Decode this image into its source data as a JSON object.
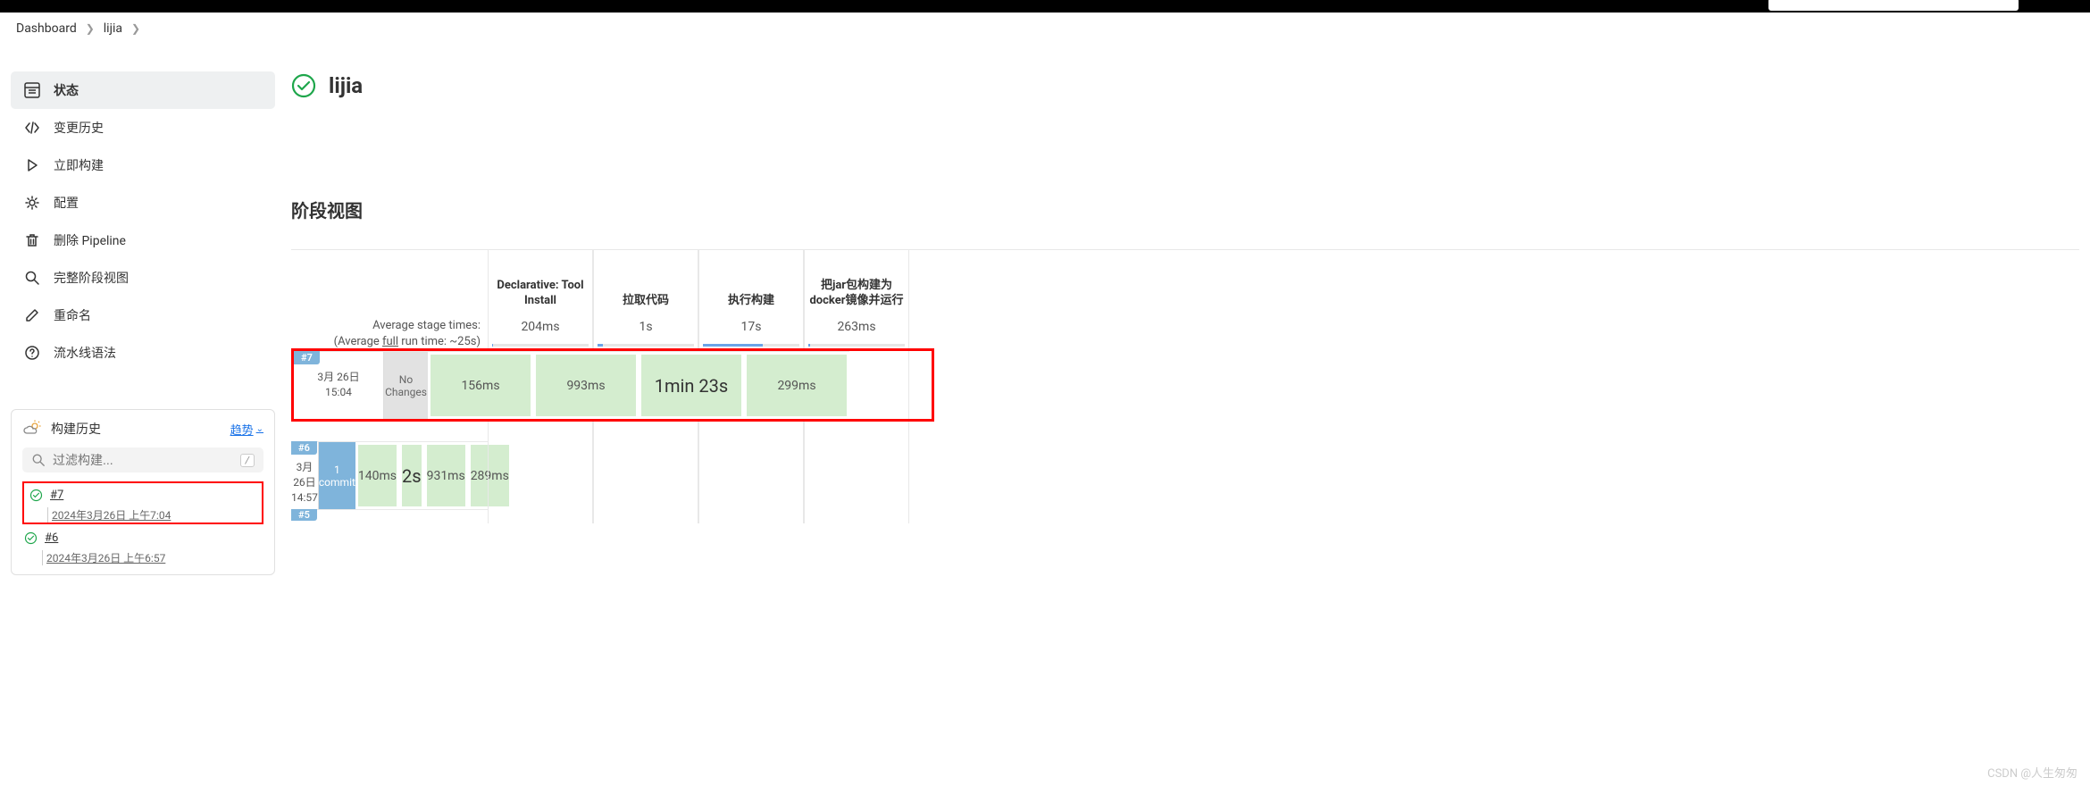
{
  "breadcrumb": {
    "dashboard": "Dashboard",
    "project": "lijia"
  },
  "sidebar": {
    "items": [
      {
        "label": "状态"
      },
      {
        "label": "变更历史"
      },
      {
        "label": "立即构建"
      },
      {
        "label": "配置"
      },
      {
        "label": "删除 Pipeline"
      },
      {
        "label": "完整阶段视图"
      },
      {
        "label": "重命名"
      },
      {
        "label": "流水线语法"
      }
    ]
  },
  "build_history": {
    "title": "构建历史",
    "trend": "趋势",
    "filter_placeholder": "过滤构建...",
    "builds": [
      {
        "num": "#7",
        "date": "2024年3月26日 上午7:04"
      },
      {
        "num": "#6",
        "date": "2024年3月26日 上午6:57"
      }
    ]
  },
  "page": {
    "title": "lijia",
    "stage_title": "阶段视图"
  },
  "stage": {
    "headers": [
      "Declarative: Tool Install",
      "拉取代码",
      "执行构建",
      "把jar包构建为docker镜像并运行"
    ],
    "avg_label_line1": "Average stage times:",
    "avg_label_line2_a": "(Average ",
    "avg_label_line2_b": "full",
    "avg_label_line2_c": " run time: ~25s)",
    "avg_values": [
      "204ms",
      "1s",
      "17s",
      "263ms"
    ],
    "avg_fill": [
      1,
      6,
      62,
      2
    ],
    "runs": [
      {
        "badge": "#7",
        "date1": "3月 26日",
        "date2": "15:04",
        "commit_l1": "No",
        "commit_l2": "Changes",
        "commit_style": "gray",
        "cells": [
          "156ms",
          "993ms",
          "1min 23s",
          "299ms"
        ],
        "big_index": 2,
        "highlight": true
      },
      {
        "badge": "#6",
        "date1": "3月 26日",
        "date2": "14:57",
        "commit_l1": "1",
        "commit_l2": "commit",
        "commit_style": "blue",
        "cells": [
          "140ms",
          "2s",
          "931ms",
          "289ms"
        ],
        "big_index": 1,
        "highlight": false
      }
    ],
    "next_badge": "#5"
  },
  "watermark": "CSDN @人生匆匆"
}
